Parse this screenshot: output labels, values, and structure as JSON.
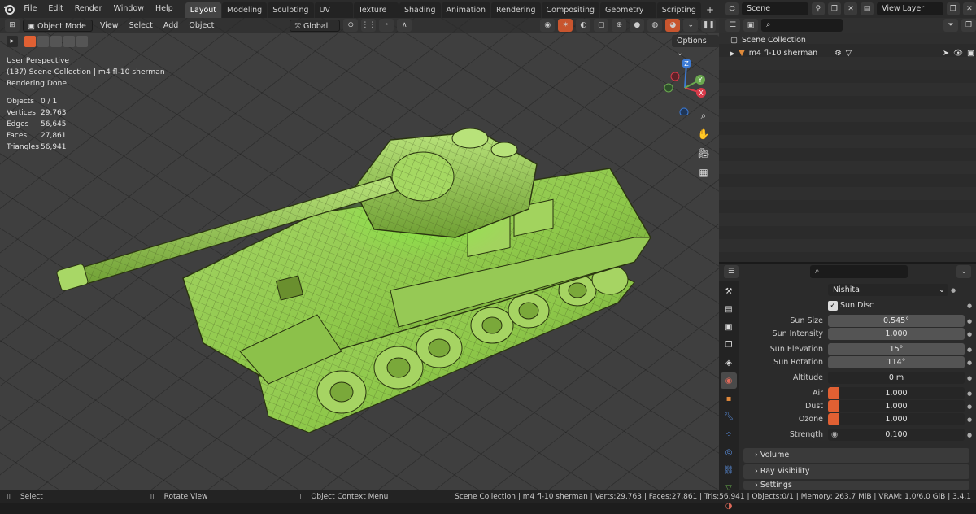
{
  "menus": [
    "File",
    "Edit",
    "Render",
    "Window",
    "Help"
  ],
  "workspaces": [
    "Layout",
    "Modeling",
    "Sculpting",
    "UV Editing",
    "Texture Paint",
    "Shading",
    "Animation",
    "Rendering",
    "Compositing",
    "Geometry Nodes",
    "Scripting"
  ],
  "tab_add": "+",
  "scene_field": "Scene",
  "viewlayer_field": "View Layer",
  "viewport": {
    "mode": "Object Mode",
    "menu": [
      "View",
      "Select",
      "Add",
      "Object"
    ],
    "orientation": "Global",
    "options_label": "Options",
    "overlay_lines": [
      "User Perspective",
      "(137) Scene Collection | m4 fl-10 sherman",
      "Rendering Done"
    ],
    "stats": [
      {
        "k": "Objects",
        "v": "0 / 1"
      },
      {
        "k": "Vertices",
        "v": "29,763"
      },
      {
        "k": "Edges",
        "v": "56,645"
      },
      {
        "k": "Faces",
        "v": "27,861"
      },
      {
        "k": "Triangles",
        "v": "56,941"
      }
    ],
    "gizmo": {
      "x": "X",
      "y": "Y",
      "z": "Z"
    }
  },
  "outliner": {
    "root": "Scene Collection",
    "object": "m4 fl-10 sherman"
  },
  "properties": {
    "sky_type": "Nishita",
    "sun_disc_label": "Sun Disc",
    "rows": [
      {
        "label": "Sun Size",
        "value": "0.545°"
      },
      {
        "label": "Sun Intensity",
        "value": "1.000"
      },
      {
        "label": "Sun Elevation",
        "value": "15°"
      },
      {
        "label": "Sun Rotation",
        "value": "114°"
      },
      {
        "label": "Altitude",
        "value": "0 m"
      },
      {
        "label": "Air",
        "value": "1.000"
      },
      {
        "label": "Dust",
        "value": "1.000"
      },
      {
        "label": "Ozone",
        "value": "1.000"
      },
      {
        "label": "Strength",
        "value": "0.100"
      }
    ],
    "sections": [
      "Volume",
      "Ray Visibility",
      "Settings"
    ]
  },
  "status": {
    "select": "Select",
    "rotate": "Rotate View",
    "context": "Object Context Menu",
    "info": "Scene Collection | m4 fl-10 sherman | Verts:29,763 | Faces:27,861 | Tris:56,941 | Objects:0/1 | Memory: 263.7 MiB | VRAM: 1.0/6.0 GiB | 3.4.1"
  }
}
